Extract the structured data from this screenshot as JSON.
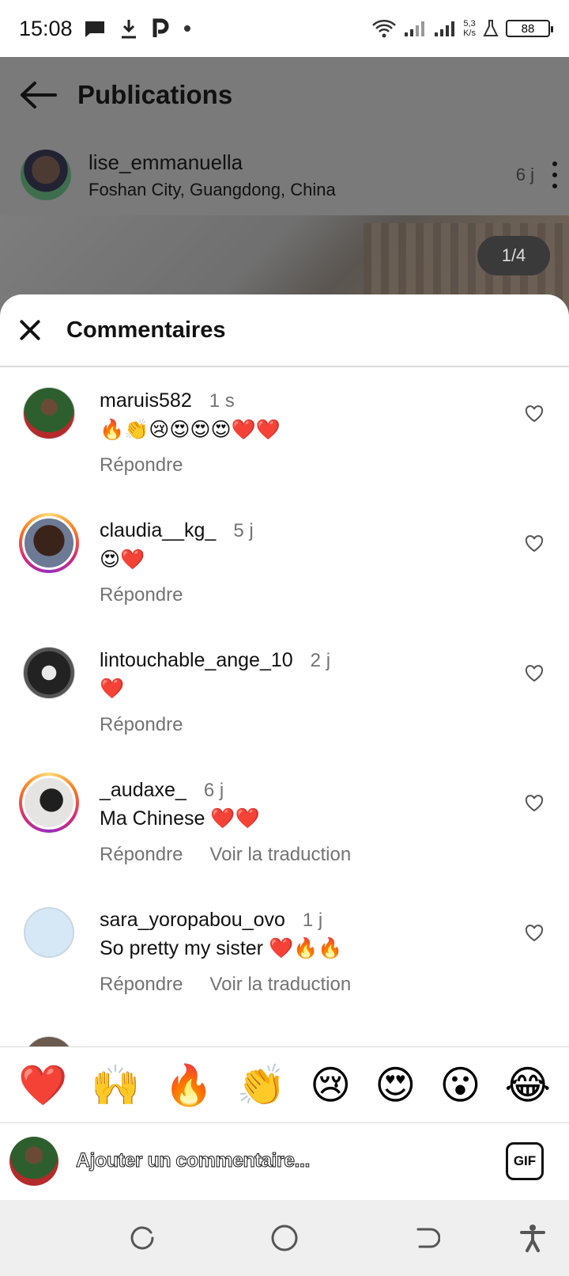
{
  "status_bar": {
    "time": "15:08",
    "net_speed_value": "5,3",
    "net_speed_unit": "K/s",
    "battery": "88"
  },
  "post": {
    "header_title": "Publications",
    "username": "lise_emmanuella",
    "location": "Foshan City, Guangdong, China",
    "time": "6 j",
    "page_counter": "1/4"
  },
  "comments_sheet": {
    "title": "Commentaires",
    "reply_label": "Répondre",
    "translate_label": "Voir la traduction",
    "comments": [
      {
        "user": "maruis582",
        "time": "1 s",
        "text": "",
        "emoji": "🔥👏😢😍😍😍❤️❤️",
        "show_translate": false
      },
      {
        "user": "claudia__kg_",
        "time": "5 j",
        "text": "",
        "emoji": "😍❤️",
        "show_translate": false
      },
      {
        "user": "lintouchable_ange_10",
        "time": "2 j",
        "text": "",
        "emoji": "❤️",
        "show_translate": false
      },
      {
        "user": "_audaxe_",
        "time": "6 j",
        "text": "Ma Chinese",
        "emoji": "❤️❤️",
        "show_translate": true
      },
      {
        "user": "sara_yoropabou_ovo",
        "time": "1 j",
        "text": "So pretty my sister",
        "emoji": "❤️🔥🔥",
        "show_translate": true
      }
    ]
  },
  "reactions": [
    "❤️",
    "🙌",
    "🔥",
    "👏",
    "😢",
    "😍",
    "😮",
    "😂"
  ],
  "add_comment": {
    "placeholder": "Ajouter un commentaire...",
    "gif_label": "GIF"
  }
}
